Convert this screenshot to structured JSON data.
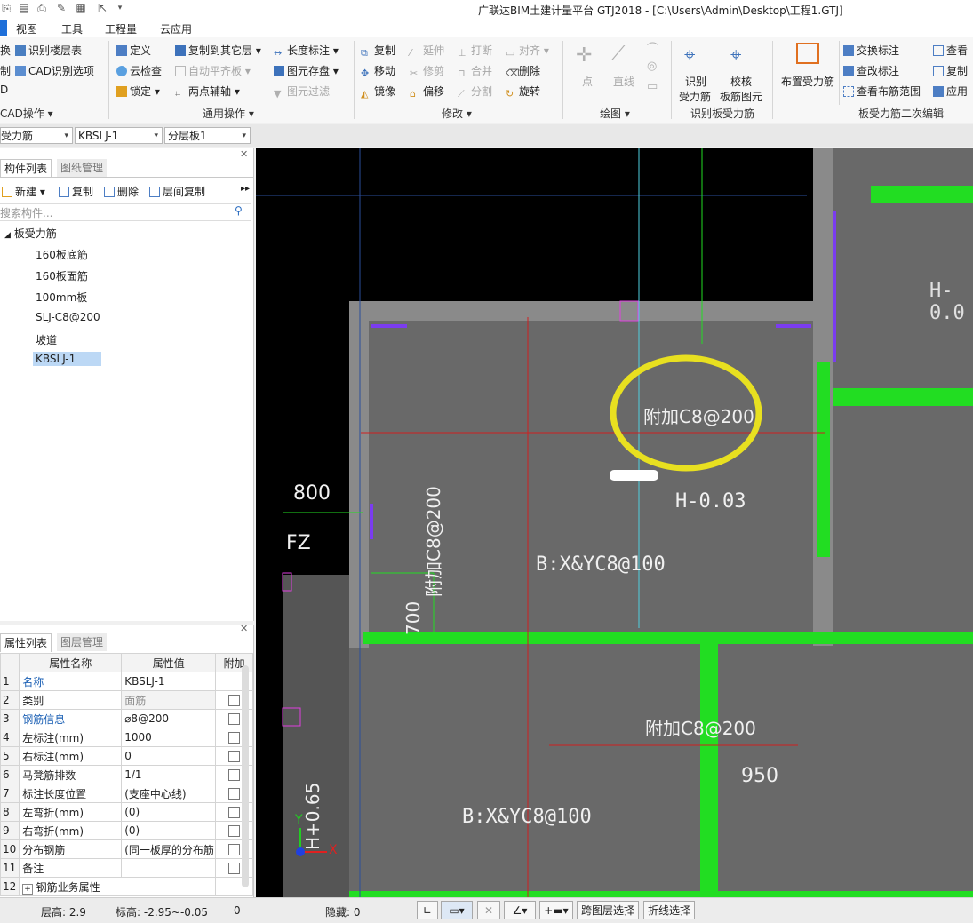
{
  "window": {
    "title": "广联达BIM土建计量平台 GTJ2018 - [C:\\Users\\Admin\\Desktop\\工程1.GTJ]"
  },
  "menu": {
    "items": [
      "视图",
      "工具",
      "工程量",
      "云应用"
    ]
  },
  "ribbon": {
    "cad": {
      "btn1": "识别楼层表",
      "btn2": "CAD识别选项",
      "group": "CAD操作"
    },
    "general": {
      "define": "定义",
      "cloud_check": "云检查",
      "lock": "锁定",
      "copy_to_layer": "复制到其它层",
      "auto_level": "自动平齐板",
      "two_point_axis": "两点辅轴",
      "length_label": "长度标注",
      "elem_store": "图元存盘",
      "elem_filter": "图元过滤",
      "group": "通用操作"
    },
    "modify": {
      "copy": "复制",
      "extend": "延伸",
      "break": "打断",
      "align": "对齐",
      "move": "移动",
      "trim": "修剪",
      "merge": "合并",
      "delete": "删除",
      "mirror": "镜像",
      "offset": "偏移",
      "split": "分割",
      "rotate": "旋转",
      "group": "修改"
    },
    "draw": {
      "point": "点",
      "line": "直线",
      "group": "绘图"
    },
    "recognize": {
      "identify": "识别",
      "identify2": "受力筋",
      "verify": "校核",
      "verify2": "板筋图元",
      "group": "识别板受力筋"
    },
    "layout": {
      "place": "布置受力筋"
    },
    "secondary": {
      "swap_label": "交换标注",
      "check_label": "查改标注",
      "view_range": "查看布筋范围",
      "view": "查看",
      "copy": "复制",
      "apply": "应用",
      "group": "板受力筋二次编辑"
    }
  },
  "combos": {
    "type": "受力筋",
    "name": "KBSLJ-1",
    "layer": "分层板1"
  },
  "component_panel": {
    "tab_active": "构件列表",
    "tab_inactive": "图纸管理",
    "toolbar": {
      "new": "新建",
      "copy": "复制",
      "delete": "删除",
      "floor_copy": "层间复制"
    },
    "search_placeholder": "搜索构件...",
    "tree_root": "板受力筋",
    "tree_items": [
      "160板底筋",
      "160板面筋",
      "100mm板",
      "SLJ-C8@200",
      "坡道",
      "KBSLJ-1"
    ]
  },
  "property_panel": {
    "tab_active": "属性列表",
    "tab_inactive": "图层管理",
    "headers": [
      "属性名称",
      "属性值",
      "附加"
    ],
    "rows": [
      {
        "num": "1",
        "name": "名称",
        "value": "KBSLJ-1"
      },
      {
        "num": "2",
        "name": "类别",
        "value": "面筋"
      },
      {
        "num": "3",
        "name": "钢筋信息",
        "value": "⌀8@200"
      },
      {
        "num": "4",
        "name": "左标注(mm)",
        "value": "1000"
      },
      {
        "num": "5",
        "name": "右标注(mm)",
        "value": "0"
      },
      {
        "num": "6",
        "name": "马凳筋排数",
        "value": "1/1"
      },
      {
        "num": "7",
        "name": "标注长度位置",
        "value": "(支座中心线)"
      },
      {
        "num": "8",
        "name": "左弯折(mm)",
        "value": "(0)"
      },
      {
        "num": "9",
        "name": "右弯折(mm)",
        "value": "(0)"
      },
      {
        "num": "10",
        "name": "分布钢筋",
        "value": "(同一板厚的分布筋"
      },
      {
        "num": "11",
        "name": "备注",
        "value": ""
      },
      {
        "num": "12",
        "name": "钢筋业务属性",
        "value": ""
      }
    ]
  },
  "canvas": {
    "label_h_top": "H-0.0",
    "label_extra_1": "附加C8@200",
    "label_h_mid": "H-0.03",
    "label_dim_800": "800",
    "label_fz": "FZ",
    "label_extra_vert": "附加C8@200",
    "label_bx_1": "B:X&YC8@100",
    "label_dim_700": "700",
    "label_extra_2": "附加C8@200",
    "label_dim_950": "950",
    "label_bx_2": "B:X&YC8@100",
    "label_h_left": "H+0.65",
    "axis_x": "X",
    "axis_y": "Y"
  },
  "status": {
    "floor_height": "层高:  2.9",
    "elevation": "标高:  -2.95~-0.05",
    "count": "0",
    "hidden": "隐藏:  0",
    "cross_layer": "跨图层选择",
    "polyline": "折线选择"
  }
}
